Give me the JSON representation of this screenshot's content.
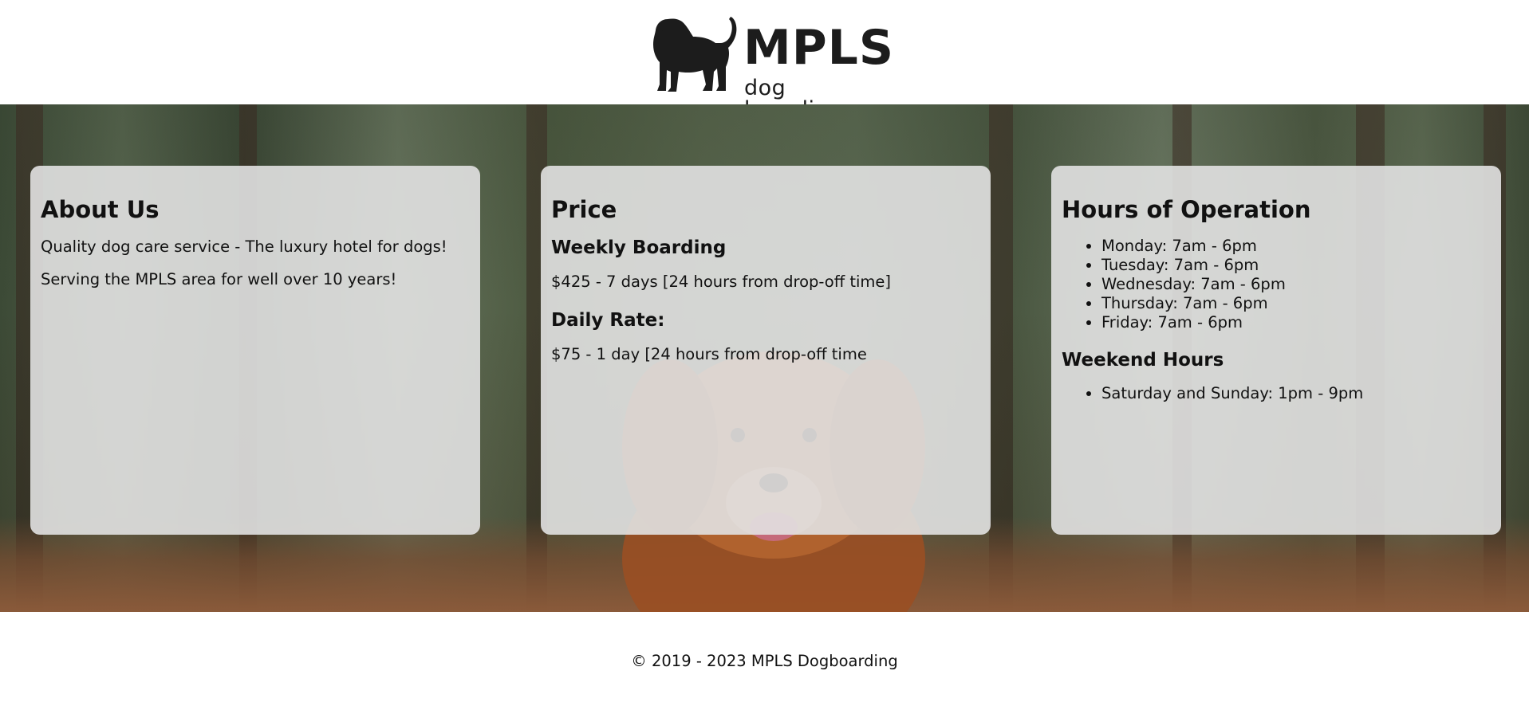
{
  "header": {
    "brand_title": "MPLS",
    "brand_subtitle": "dog boarding",
    "logo_icon": "dog-silhouette-icon"
  },
  "about": {
    "heading": "About Us",
    "paragraphs": [
      "Quality dog care service - The luxury hotel for dogs!",
      "Serving the MPLS area for well over 10 years!"
    ]
  },
  "price": {
    "heading": "Price",
    "weekly_heading": "Weekly Boarding",
    "weekly_text": "$425 - 7 days [24 hours from drop-off time]",
    "daily_heading": "Daily Rate:",
    "daily_text": "$75 - 1 day [24 hours from drop-off time"
  },
  "hours": {
    "heading": "Hours of Operation",
    "weekdays": [
      "Monday: 7am - 6pm",
      "Tuesday: 7am - 6pm",
      "Wednesday: 7am - 6pm",
      "Thursday: 7am - 6pm",
      "Friday: 7am - 6pm"
    ],
    "weekend_heading": "Weekend Hours",
    "weekend": [
      "Saturday and Sunday: 1pm - 9pm"
    ]
  },
  "footer": {
    "copyright": "© 2019 - 2023 MPLS Dogboarding"
  },
  "colors": {
    "card_background": "#e2e2e2",
    "text": "#111111",
    "logo": "#1c1c1c"
  }
}
